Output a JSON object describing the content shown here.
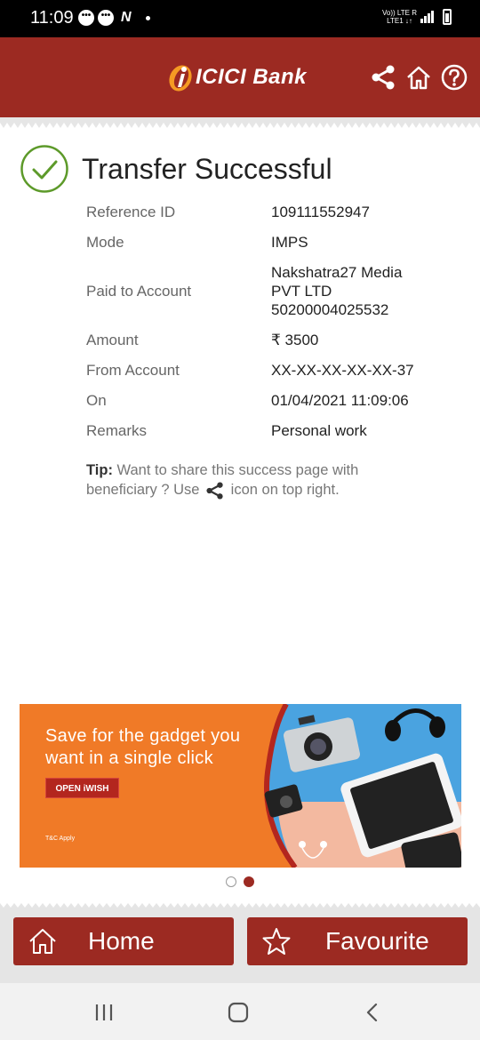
{
  "status_bar": {
    "time": "11:09",
    "network_top": "Vo)) LTE R",
    "network_bottom": "LTE1 ↓↑"
  },
  "header": {
    "brand": "ICICI Bank",
    "icons": [
      "share-icon",
      "home-icon",
      "help-icon"
    ],
    "brand_color": "#9c2a22"
  },
  "result": {
    "title": "Transfer Successful",
    "status_color": "#5d9a2a"
  },
  "details": {
    "reference_label": "Reference ID",
    "reference_value": "109111552947",
    "mode_label": "Mode",
    "mode_value": "IMPS",
    "paid_to_label": "Paid to Account",
    "paid_to_line1": "Nakshatra27 Media",
    "paid_to_line2": "PVT LTD",
    "paid_to_line3": "50200004025532",
    "amount_label": "Amount",
    "amount_value": "₹ 3500",
    "from_label": "From Account",
    "from_value": "XX-XX-XX-XX-XX-37",
    "on_label": "On",
    "on_value": "01/04/2021 11:09:06",
    "remarks_label": "Remarks",
    "remarks_value": "Personal work"
  },
  "tip": {
    "prefix": "Tip:",
    "text_before": "Want to share this success page with beneficiary ? Use",
    "text_after": "icon on top right."
  },
  "banner": {
    "headline": "Save for the gadget you want in a single click",
    "cta": "OPEN iWISH",
    "terms": "T&C Apply",
    "page_index": 2,
    "page_count": 2
  },
  "actions": {
    "home": "Home",
    "favourite": "Favourite"
  }
}
